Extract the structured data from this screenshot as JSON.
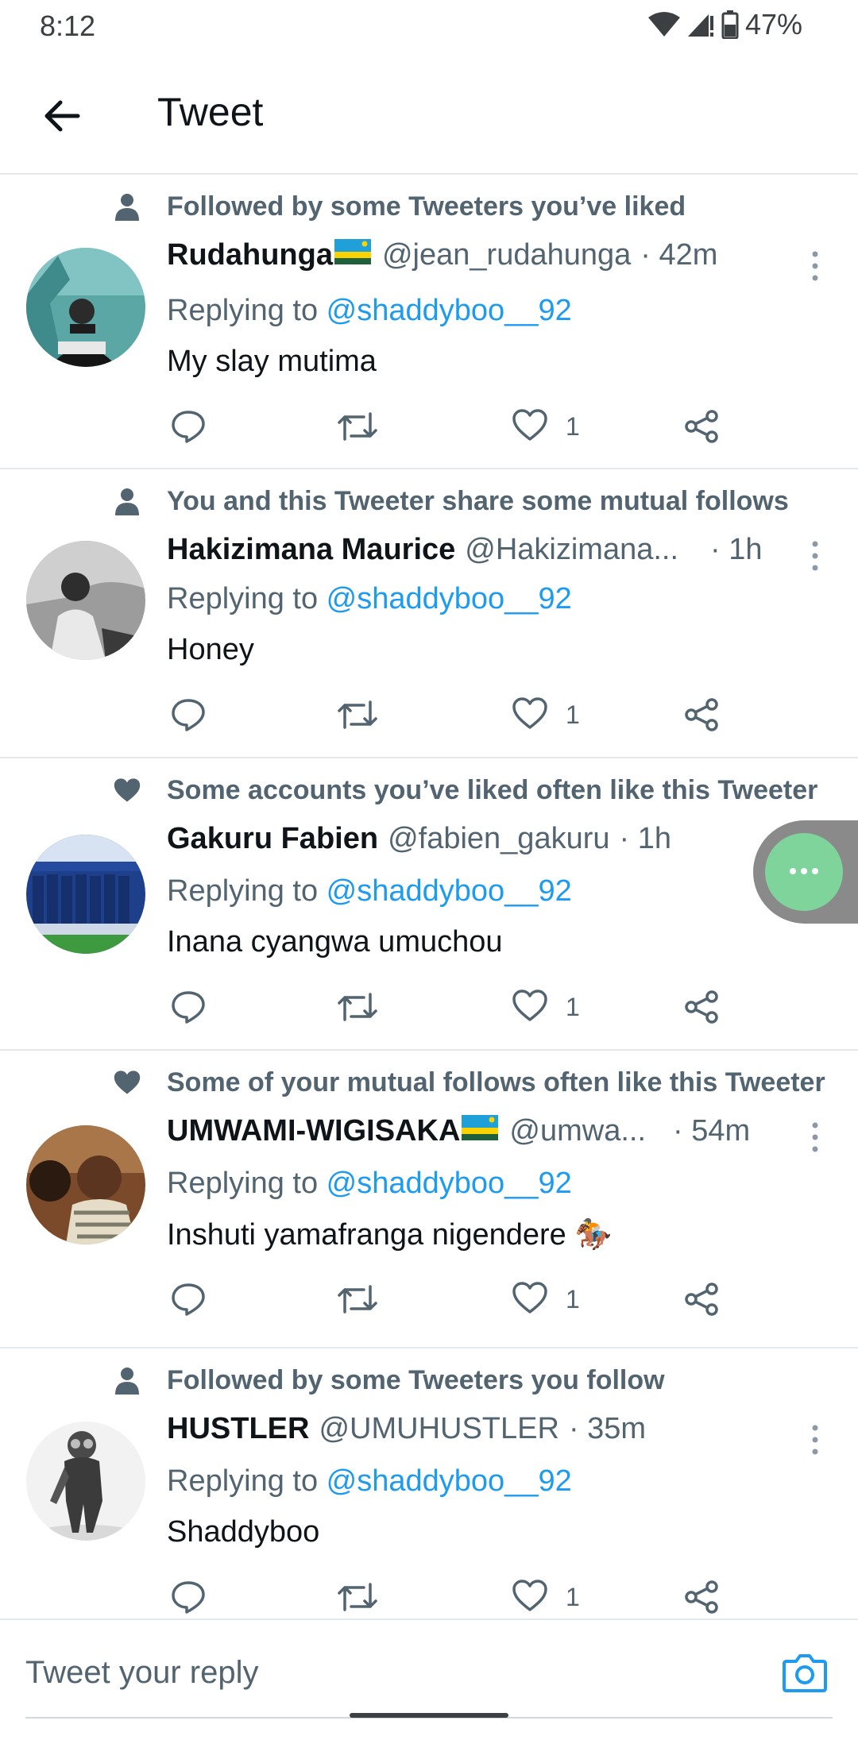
{
  "status": {
    "time": "8:12",
    "battery": "47%"
  },
  "header": {
    "title": "Tweet"
  },
  "tweets": [
    {
      "social": "Followed by some Tweeters you’ve liked",
      "social_icon": "person-icon",
      "name": "Rudahunga",
      "flag": "rwanda-flag",
      "handle": "@jean_rudahunga",
      "time": "· 42m",
      "replying_prefix": "Replying to ",
      "replying_to": "@shaddyboo__92",
      "text": "My slay mutima",
      "likes": "1"
    },
    {
      "social": "You and this Tweeter share some mutual follows",
      "social_icon": "person-icon",
      "name": "Hakizimana Maurice",
      "flag": "",
      "handle": "@Hakizimana...",
      "time": "· 1h",
      "replying_prefix": "Replying to ",
      "replying_to": "@shaddyboo__92",
      "text": "Honey",
      "likes": "1"
    },
    {
      "social": "Some accounts you’ve liked often like this Tweeter",
      "social_icon": "heart-icon",
      "name": "Gakuru Fabien",
      "flag": "",
      "handle": "@fabien_gakuru",
      "time": "· 1h",
      "replying_prefix": "Replying to ",
      "replying_to": "@shaddyboo__92",
      "text": "Inana cyangwa umuchou",
      "likes": "1"
    },
    {
      "social": "Some of your mutual follows often like this Tweeter",
      "social_icon": "heart-icon",
      "name": "UMWAMI-WIGISAKA",
      "flag": "rwanda-flag",
      "handle": "@umwa...",
      "time": "· 54m",
      "replying_prefix": "Replying to ",
      "replying_to": "@shaddyboo__92",
      "text": "Inshuti yamafranga nigendere 🏇",
      "likes": "1"
    },
    {
      "social": "Followed by some Tweeters you follow",
      "social_icon": "person-icon",
      "name": "HUSTLER",
      "flag": "",
      "handle": "@UMUHUSTLER",
      "time": "· 35m",
      "replying_prefix": "Replying to ",
      "replying_to": "@shaddyboo__92",
      "text": "Shaddyboo",
      "likes": "1"
    }
  ],
  "reply_bar": {
    "placeholder": "Tweet your reply"
  },
  "colors": {
    "link": "#1d9bf0",
    "secondary": "#536471",
    "fab": "#7fd49c"
  }
}
